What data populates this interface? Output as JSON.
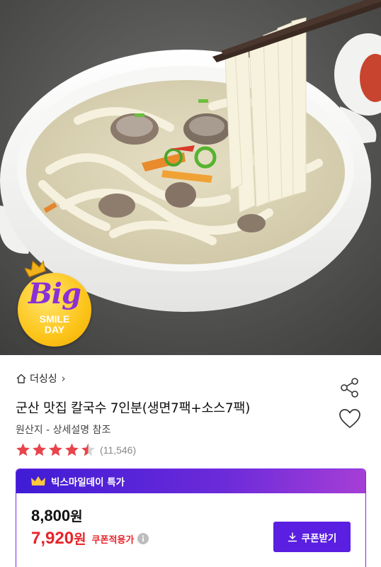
{
  "hero": {
    "badge": {
      "big": "Big",
      "line1": "SMILE",
      "line2": "DAY"
    }
  },
  "product": {
    "brand": "더싱싱",
    "title": "군산 맛집 칼국수 7인분(생면7팩+소스7팩)",
    "origin": "원산지 - 상세설명 참조",
    "rating": {
      "stars": 4.5,
      "count": "(11,546)"
    }
  },
  "deal": {
    "header": "빅스마일데이 특가",
    "original_price": "8,800",
    "sale_price": "7,920",
    "currency": "원",
    "coupon_note": "쿠폰적용가",
    "coupon_button": "쿠폰받기"
  },
  "colors": {
    "accent_purple": "#5a1fe0",
    "sale_red": "#e8232a",
    "star_red": "#e8444b"
  },
  "icons": [
    "home-icon",
    "chevron-right-icon",
    "share-icon",
    "heart-icon",
    "star-icon",
    "crown-icon",
    "info-icon",
    "download-icon"
  ]
}
